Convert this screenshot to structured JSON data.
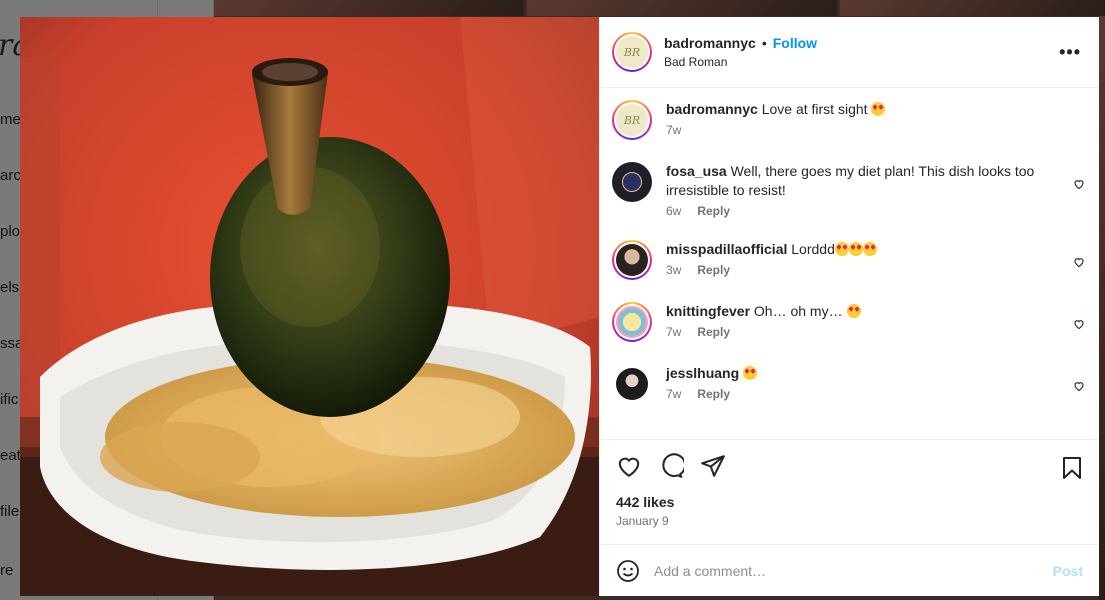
{
  "background": {
    "logo_fragment": "ra",
    "nav_fragments": [
      "me",
      "arch",
      "plor",
      "els",
      "ssa",
      "ific",
      "eate",
      "file",
      "re"
    ]
  },
  "post": {
    "author": {
      "username": "badromannyc",
      "display_name": "Bad Roman",
      "avatar_initials": "BR"
    },
    "follow_label": "Follow",
    "separator": "•",
    "caption": {
      "username": "badromannyc",
      "text": "Love at first sight",
      "age": "7w"
    },
    "comments": [
      {
        "username": "fosa_usa",
        "text": "Well, there goes my diet plan! This dish looks too irresistible to resist!",
        "age": "6w",
        "reply": "Reply"
      },
      {
        "username": "misspadillaofficial",
        "text": "Lorddd",
        "emoji_count": 3,
        "age": "3w",
        "reply": "Reply"
      },
      {
        "username": "knittingfever",
        "text": "Oh… oh my…",
        "emoji_count": 1,
        "age": "7w",
        "reply": "Reply"
      },
      {
        "username": "jesslhuang",
        "text": "",
        "emoji_count": 1,
        "age": "7w",
        "reply": "Reply"
      }
    ],
    "likes": "442 likes",
    "date": "January 9",
    "add_comment_placeholder": "Add a comment…",
    "post_label": "Post"
  },
  "colors": {
    "accent": "#0095f6",
    "post_disabled": "#b2dffc",
    "text": "#262626",
    "muted": "#737373"
  }
}
